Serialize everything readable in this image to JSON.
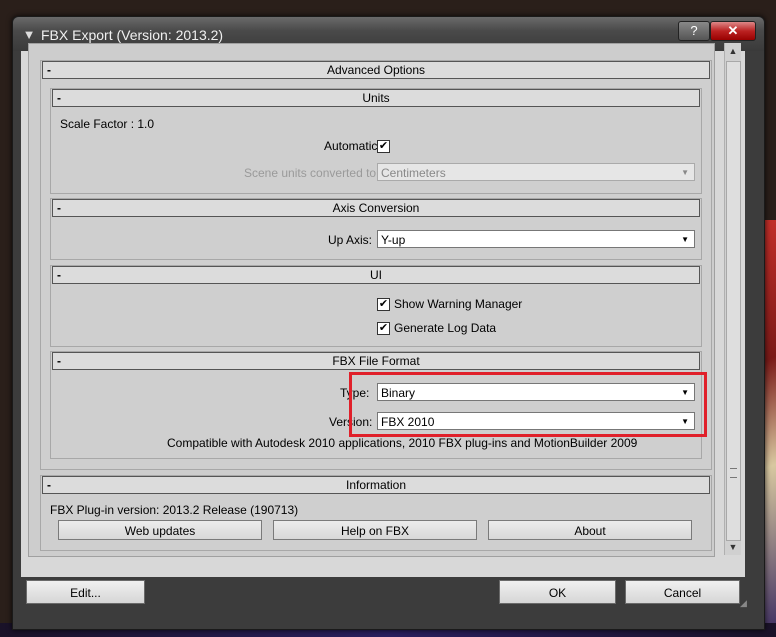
{
  "window": {
    "title": "FBX Export (Version: 2013.2)",
    "help_label": "?",
    "close_label": "✕"
  },
  "advanced": {
    "title": "Advanced Options",
    "collapse": "-"
  },
  "units": {
    "title": "Units",
    "collapse": "-",
    "scale_factor_label": "Scale Factor : 1.0",
    "automatic_label": "Automatic",
    "automatic_checked": "✔",
    "converted_label": "Scene units converted to:",
    "converted_value": "Centimeters"
  },
  "axis": {
    "title": "Axis Conversion",
    "collapse": "-",
    "up_axis_label": "Up Axis:",
    "up_axis_value": "Y-up"
  },
  "ui": {
    "title": "UI",
    "collapse": "-",
    "warning_label": "Show Warning Manager",
    "warning_checked": "✔",
    "log_label": "Generate Log Data",
    "log_checked": "✔"
  },
  "fbx_format": {
    "title": "FBX File Format",
    "collapse": "-",
    "type_label": "Type:",
    "type_value": "Binary",
    "version_label": "Version:",
    "version_value": "FBX 2010",
    "compat_text": "Compatible with Autodesk 2010 applications, 2010 FBX plug-ins and MotionBuilder 2009"
  },
  "information": {
    "title": "Information",
    "collapse": "-",
    "plugin_version": "FBX Plug-in version: 2013.2 Release (190713)",
    "web_updates": "Web updates",
    "help_on_fbx": "Help on FBX",
    "about": "About"
  },
  "footer": {
    "edit": "Edit...",
    "ok": "OK",
    "cancel": "Cancel"
  },
  "dropdown_arrow": "▼",
  "highlight_color": "#e0202a"
}
